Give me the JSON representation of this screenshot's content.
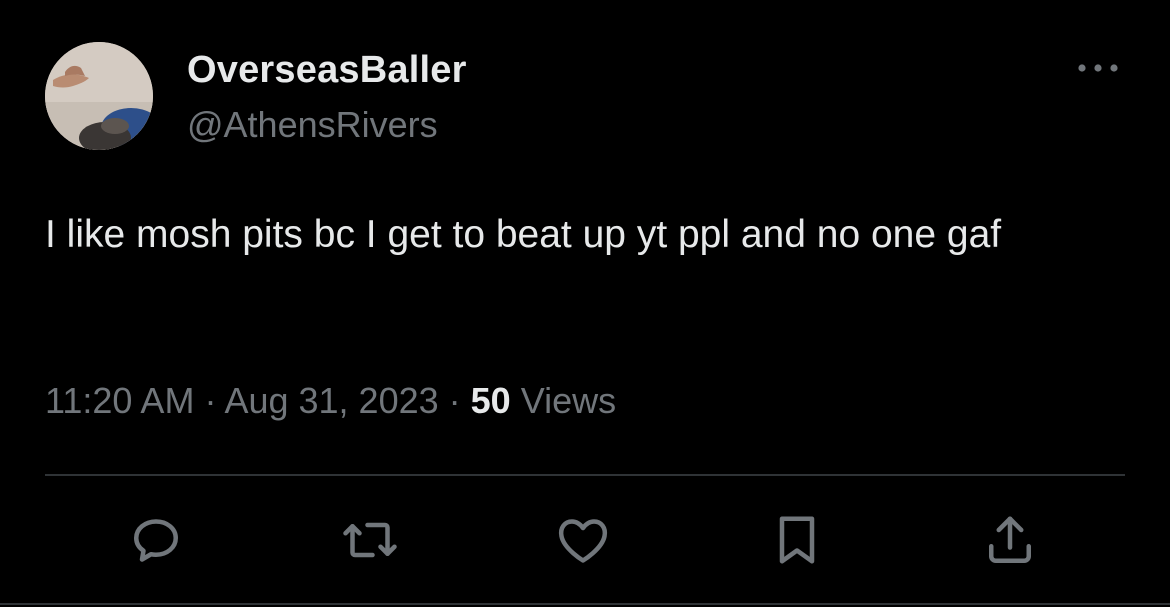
{
  "user": {
    "display_name": "OverseasBaller",
    "handle": "@AthensRivers"
  },
  "tweet": {
    "text": "I like mosh pits bc I get to beat up yt ppl and no one gaf",
    "time": "11:20 AM",
    "separator": " · ",
    "date": "Aug 31, 2023",
    "views_count": "50",
    "views_label": " Views"
  },
  "icons": {
    "more": "more-horizontal-icon",
    "reply": "reply-icon",
    "retweet": "retweet-icon",
    "like": "heart-icon",
    "bookmark": "bookmark-icon",
    "share": "share-icon"
  },
  "colors": {
    "background": "#000000",
    "primary_text": "#e7e9ea",
    "secondary_text": "#71767b",
    "divider": "#2f3336"
  }
}
